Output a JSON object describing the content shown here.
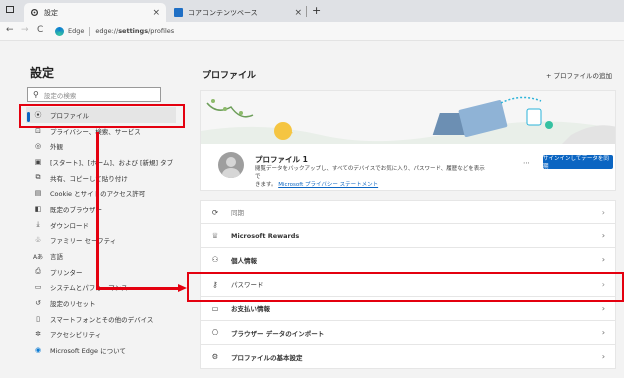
{
  "tabs": [
    {
      "label": "設定",
      "close": "×",
      "active": true
    },
    {
      "label": "コアコンテンツベース",
      "close": "×",
      "active": false
    }
  ],
  "new_tab": "+",
  "address": {
    "browser_label": "Edge",
    "url_prefix": "edge://",
    "url_host": "settings",
    "url_path": "/profiles"
  },
  "nav": {
    "back": "←",
    "forward": "→",
    "refresh": "C"
  },
  "sidebar": {
    "title": "設定",
    "search_placeholder": "設定の検索",
    "items": [
      {
        "icon": "profile-icon",
        "glyph": "⦿",
        "label": "プロファイル"
      },
      {
        "icon": "lock-icon",
        "glyph": "🔒",
        "label": "プライバシー、検索、サービス"
      },
      {
        "icon": "appearance-icon",
        "glyph": "◎",
        "label": "外観"
      },
      {
        "icon": "start-icon",
        "glyph": "▣",
        "label": "[スタート]、[ホーム]、および [新規] タブ"
      },
      {
        "icon": "share-icon",
        "glyph": "⧉",
        "label": "共有、コピーして貼り付け"
      },
      {
        "icon": "cookie-icon",
        "glyph": "▤",
        "label": "Cookie とサイトのアクセス許可"
      },
      {
        "icon": "browser-icon",
        "glyph": "◧",
        "label": "既定のブラウザー"
      },
      {
        "icon": "download-icon",
        "glyph": "⤓",
        "label": "ダウンロード"
      },
      {
        "icon": "family-icon",
        "glyph": "♧",
        "label": "ファミリー セーフティ"
      },
      {
        "icon": "language-icon",
        "glyph": "Aあ",
        "label": "言語"
      },
      {
        "icon": "printer-icon",
        "glyph": "⎙",
        "label": "プリンター"
      },
      {
        "icon": "system-icon",
        "glyph": "▭",
        "label": "システムとパフォーマンス"
      },
      {
        "icon": "reset-icon",
        "glyph": "↺",
        "label": "設定のリセット"
      },
      {
        "icon": "phone-icon",
        "glyph": "▯",
        "label": "スマートフォンとその他のデバイス"
      },
      {
        "icon": "accessibility-icon",
        "glyph": "✲",
        "label": "アクセシビリティ"
      },
      {
        "icon": "edge-icon",
        "glyph": "◉",
        "label": "Microsoft Edge について"
      }
    ]
  },
  "main": {
    "title": "プロファイル",
    "add_profile": "+ プロファイルの追加",
    "profile": {
      "name": "プロファイル 1",
      "desc_line1": "閲覧データをバックアップし、すべてのデバイスでお気に入り、パスワード、履歴などを表示で",
      "desc_line2": "きます。",
      "desc_link": "Microsoft プライバシー ステートメント",
      "more": "⋯",
      "signin_button": "サインインしてデータを同期"
    },
    "rows": [
      {
        "icon": "sync-icon",
        "glyph": "⟳",
        "label": "同期",
        "bold": false
      },
      {
        "icon": "trophy-icon",
        "glyph": "♕",
        "label": "Microsoft Rewards",
        "bold": true
      },
      {
        "icon": "personal-info-icon",
        "glyph": "⚇",
        "label": "個人情報",
        "bold": true
      },
      {
        "icon": "key-icon",
        "glyph": "⚷",
        "label": "パスワード",
        "bold": false
      },
      {
        "icon": "card-icon",
        "glyph": "▭",
        "label": "お支払い情報",
        "bold": true
      },
      {
        "icon": "import-icon",
        "glyph": "⎔",
        "label": "ブラウザー データのインポート",
        "bold": true
      },
      {
        "icon": "settings-icon",
        "glyph": "⚙",
        "label": "プロファイルの基本設定",
        "bold": true
      }
    ],
    "chevron": "›"
  },
  "colors": {
    "highlight": "#e4000f",
    "accent": "#0b65c2"
  }
}
